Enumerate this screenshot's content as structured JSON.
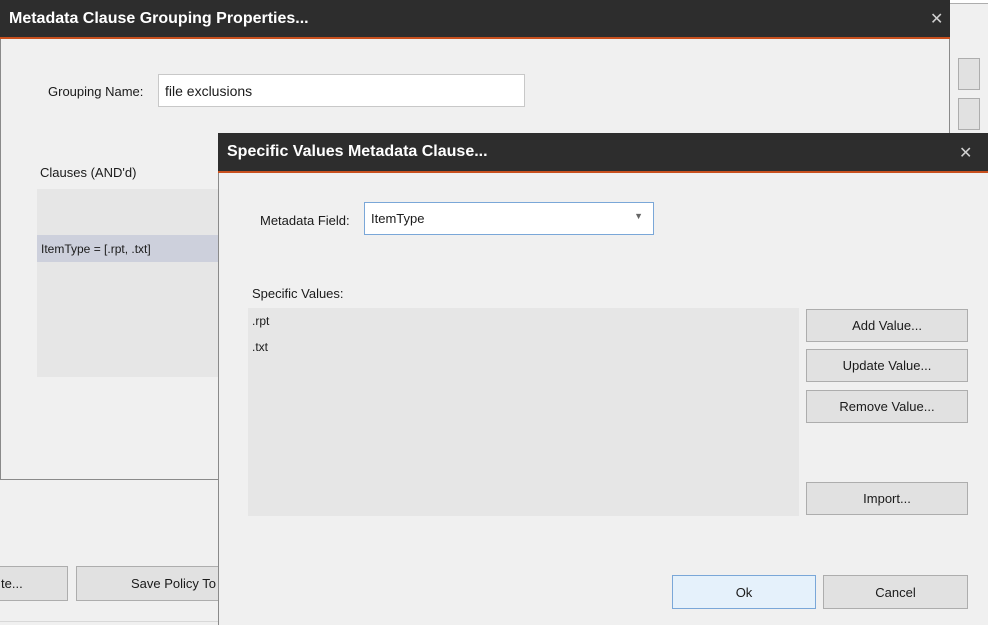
{
  "background_window": {
    "bottom_buttons": [
      "te...",
      "Save Policy To"
    ]
  },
  "grouping_dialog": {
    "title": "Metadata Clause Grouping Properties...",
    "close_glyph": "✕",
    "grouping_name_label": "Grouping Name:",
    "grouping_name_value": "file exclusions",
    "clauses_label": "Clauses (AND'd)",
    "clauses": [
      "ItemType = [.rpt, .txt]"
    ]
  },
  "values_dialog": {
    "title": "Specific Values Metadata Clause...",
    "close_glyph": "✕",
    "metadata_field_label": "Metadata Field:",
    "metadata_field_value": "ItemType",
    "specific_values_label": "Specific Values:",
    "values": [
      ".rpt",
      ".txt"
    ],
    "buttons": {
      "add": "Add Value...",
      "update": "Update Value...",
      "remove": "Remove Value...",
      "import": "Import...",
      "ok": "Ok",
      "cancel": "Cancel"
    }
  },
  "colors": {
    "titlebar": "#2d2d2d",
    "accent_line": "#c8501e",
    "selection": "#cdd0dc",
    "ok_border": "#7aa7d8"
  }
}
